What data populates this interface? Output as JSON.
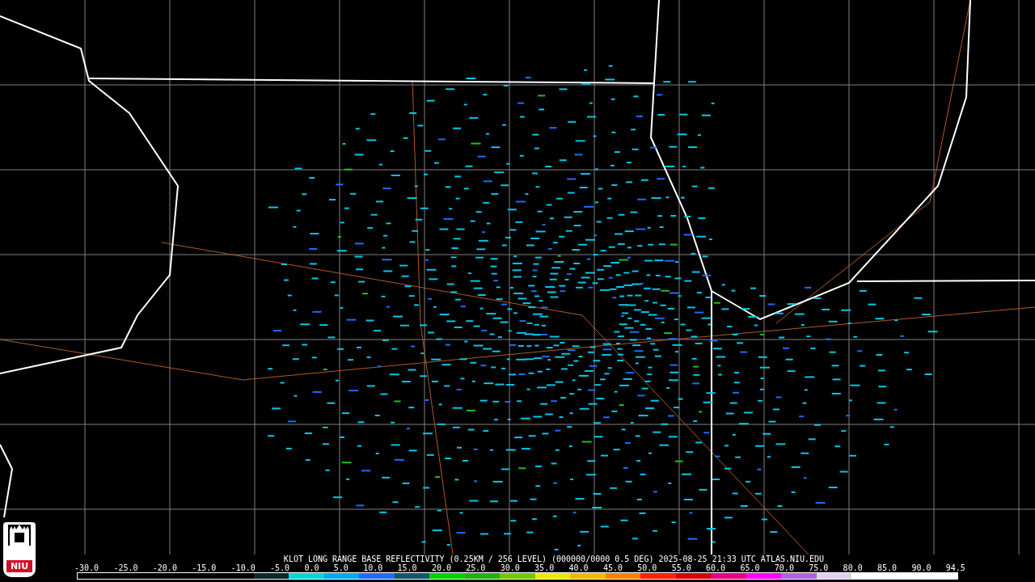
{
  "logo": {
    "text": "NIU"
  },
  "caption": "KLOT LONG RANGE BASE REFLECTIVITY (0.25KM / 256 LEVEL) (000000/0000 0.5 DEG) 2025-08-25 21:33 UTC  ATLAS.NIU.EDU",
  "legend": {
    "ticks": [
      "-30.0",
      "-25.0",
      "-20.0",
      "-15.0",
      "-10.0",
      "-5.0",
      "0.0",
      "5.0",
      "10.0",
      "15.0",
      "20.0",
      "25.0",
      "30.0",
      "35.0",
      "40.0",
      "45.0",
      "50.0",
      "55.0",
      "60.0",
      "65.0",
      "70.0",
      "75.0",
      "80.0",
      "85.0",
      "90.0",
      "94.5"
    ],
    "segments": [
      {
        "color": "#000000"
      },
      {
        "color": "#000000"
      },
      {
        "color": "#000000"
      },
      {
        "color": "#000000"
      },
      {
        "color": "#000000"
      },
      {
        "color": "#0a2a2a"
      },
      {
        "color": "#00d4d8"
      },
      {
        "color": "#00a8f0"
      },
      {
        "color": "#1e6cff"
      },
      {
        "color": "#0a5a6a"
      },
      {
        "color": "#00d000"
      },
      {
        "color": "#20b010"
      },
      {
        "color": "#70c800"
      },
      {
        "color": "#e8e800"
      },
      {
        "color": "#f0b800"
      },
      {
        "color": "#ff8000"
      },
      {
        "color": "#ff2000"
      },
      {
        "color": "#d80000"
      },
      {
        "color": "#e00080"
      },
      {
        "color": "#ff00ff"
      },
      {
        "color": "#b060e0"
      },
      {
        "color": "#e0d0f0"
      },
      {
        "color": "#ffffff"
      },
      {
        "color": "#ffffff"
      },
      {
        "color": "#ffffff"
      }
    ]
  }
}
